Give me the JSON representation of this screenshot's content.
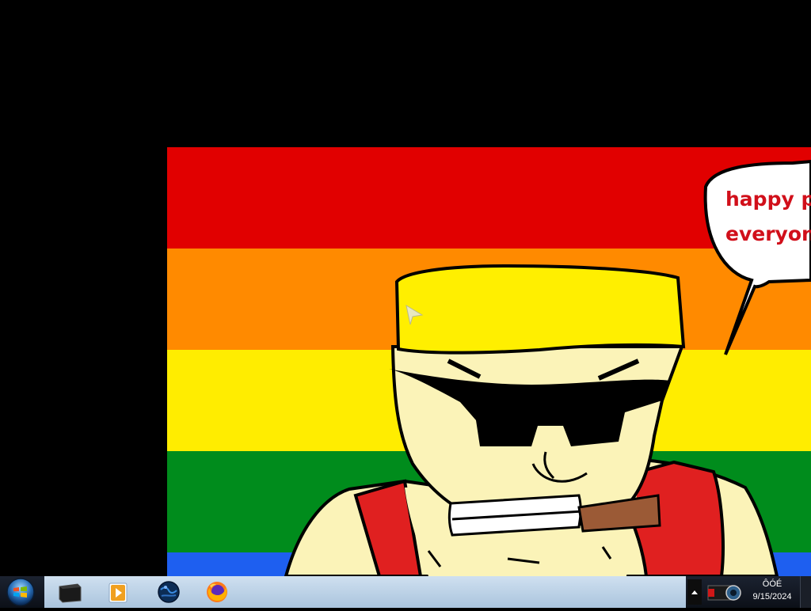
{
  "wallpaper": {
    "bubble_line1": "happy pr",
    "bubble_line2": "everyon",
    "colors": {
      "red": "#e10000",
      "orange": "#ff8a00",
      "yellow": "#ffed00",
      "green": "#008c1c",
      "blue": "#1e5ff0",
      "bubble_text": "#d10f1a"
    }
  },
  "taskbar": {
    "start_icon": "windows-orb-icon",
    "pinned": [
      {
        "icon": "black-window-app-icon"
      },
      {
        "icon": "media-player-icon"
      },
      {
        "icon": "globe-browser-icon"
      },
      {
        "icon": "firefox-icon"
      }
    ],
    "tray_arrow_icon": "chevron-up-icon",
    "tray_app_icon": "camera-app-icon",
    "clock_time": "ÔÓÉ",
    "clock_date": "9/15/2024"
  }
}
